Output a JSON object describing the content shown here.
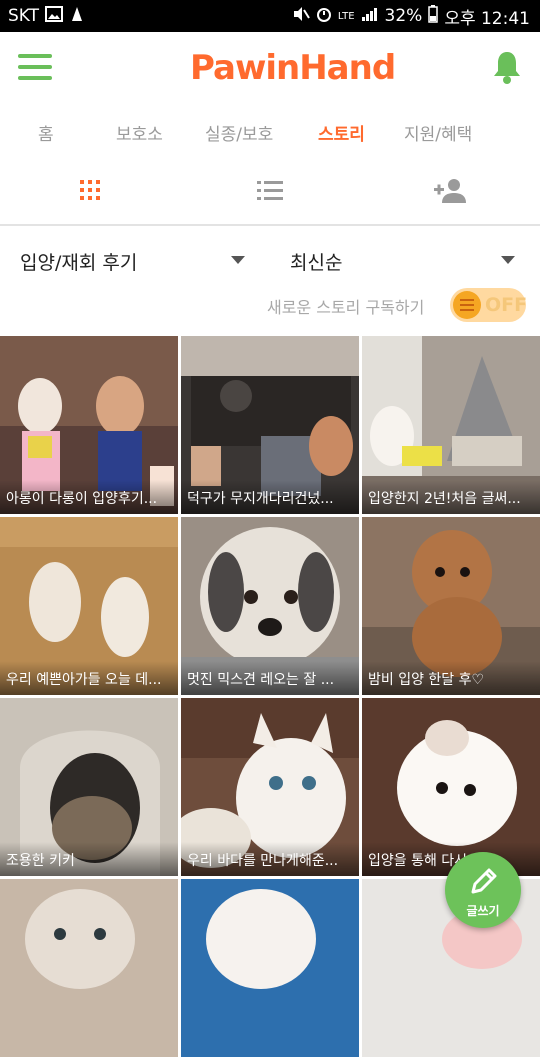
{
  "status_bar": {
    "carrier": "SKT",
    "network": "LTE",
    "battery": "32%",
    "time": "오후 12:41"
  },
  "header": {
    "logo_text": "PawinHand"
  },
  "nav": {
    "tabs": [
      {
        "label": "홈",
        "active": false
      },
      {
        "label": "보호소",
        "active": false
      },
      {
        "label": "실종/보호",
        "active": false
      },
      {
        "label": "스토리",
        "active": true
      },
      {
        "label": "지원/혜택",
        "active": false
      }
    ]
  },
  "view_modes": {
    "active": "grid",
    "icons": [
      "grid-icon",
      "list-icon",
      "add-person-icon"
    ]
  },
  "filters": {
    "category": "입양/재회 후기",
    "sort": "최신순"
  },
  "subscribe": {
    "label": "새로운 스토리 구독하기",
    "toggle_state": "OFF"
  },
  "stories": [
    {
      "caption": "아롱이 다롱이 입양후기..."
    },
    {
      "caption": "덕구가 무지개다리건넜..."
    },
    {
      "caption": "입양한지 2년!처음 글써..."
    },
    {
      "caption": "우리 예쁜아가들 오늘 데..."
    },
    {
      "caption": "멋진 믹스견 레오는 잘 ..."
    },
    {
      "caption": "밤비 입양 한달 후♡"
    },
    {
      "caption": "조용한 키키"
    },
    {
      "caption": "우리 바다를 만나게해준..."
    },
    {
      "caption": "입양을 통해 다시 찾은..."
    },
    {
      "caption": ""
    },
    {
      "caption": ""
    },
    {
      "caption": ""
    }
  ],
  "fab": {
    "label": "글쓰기"
  },
  "colors": {
    "brand_orange": "#ff6a2e",
    "brand_green": "#6abf5a",
    "inactive_tab": "#9a9a9a"
  }
}
